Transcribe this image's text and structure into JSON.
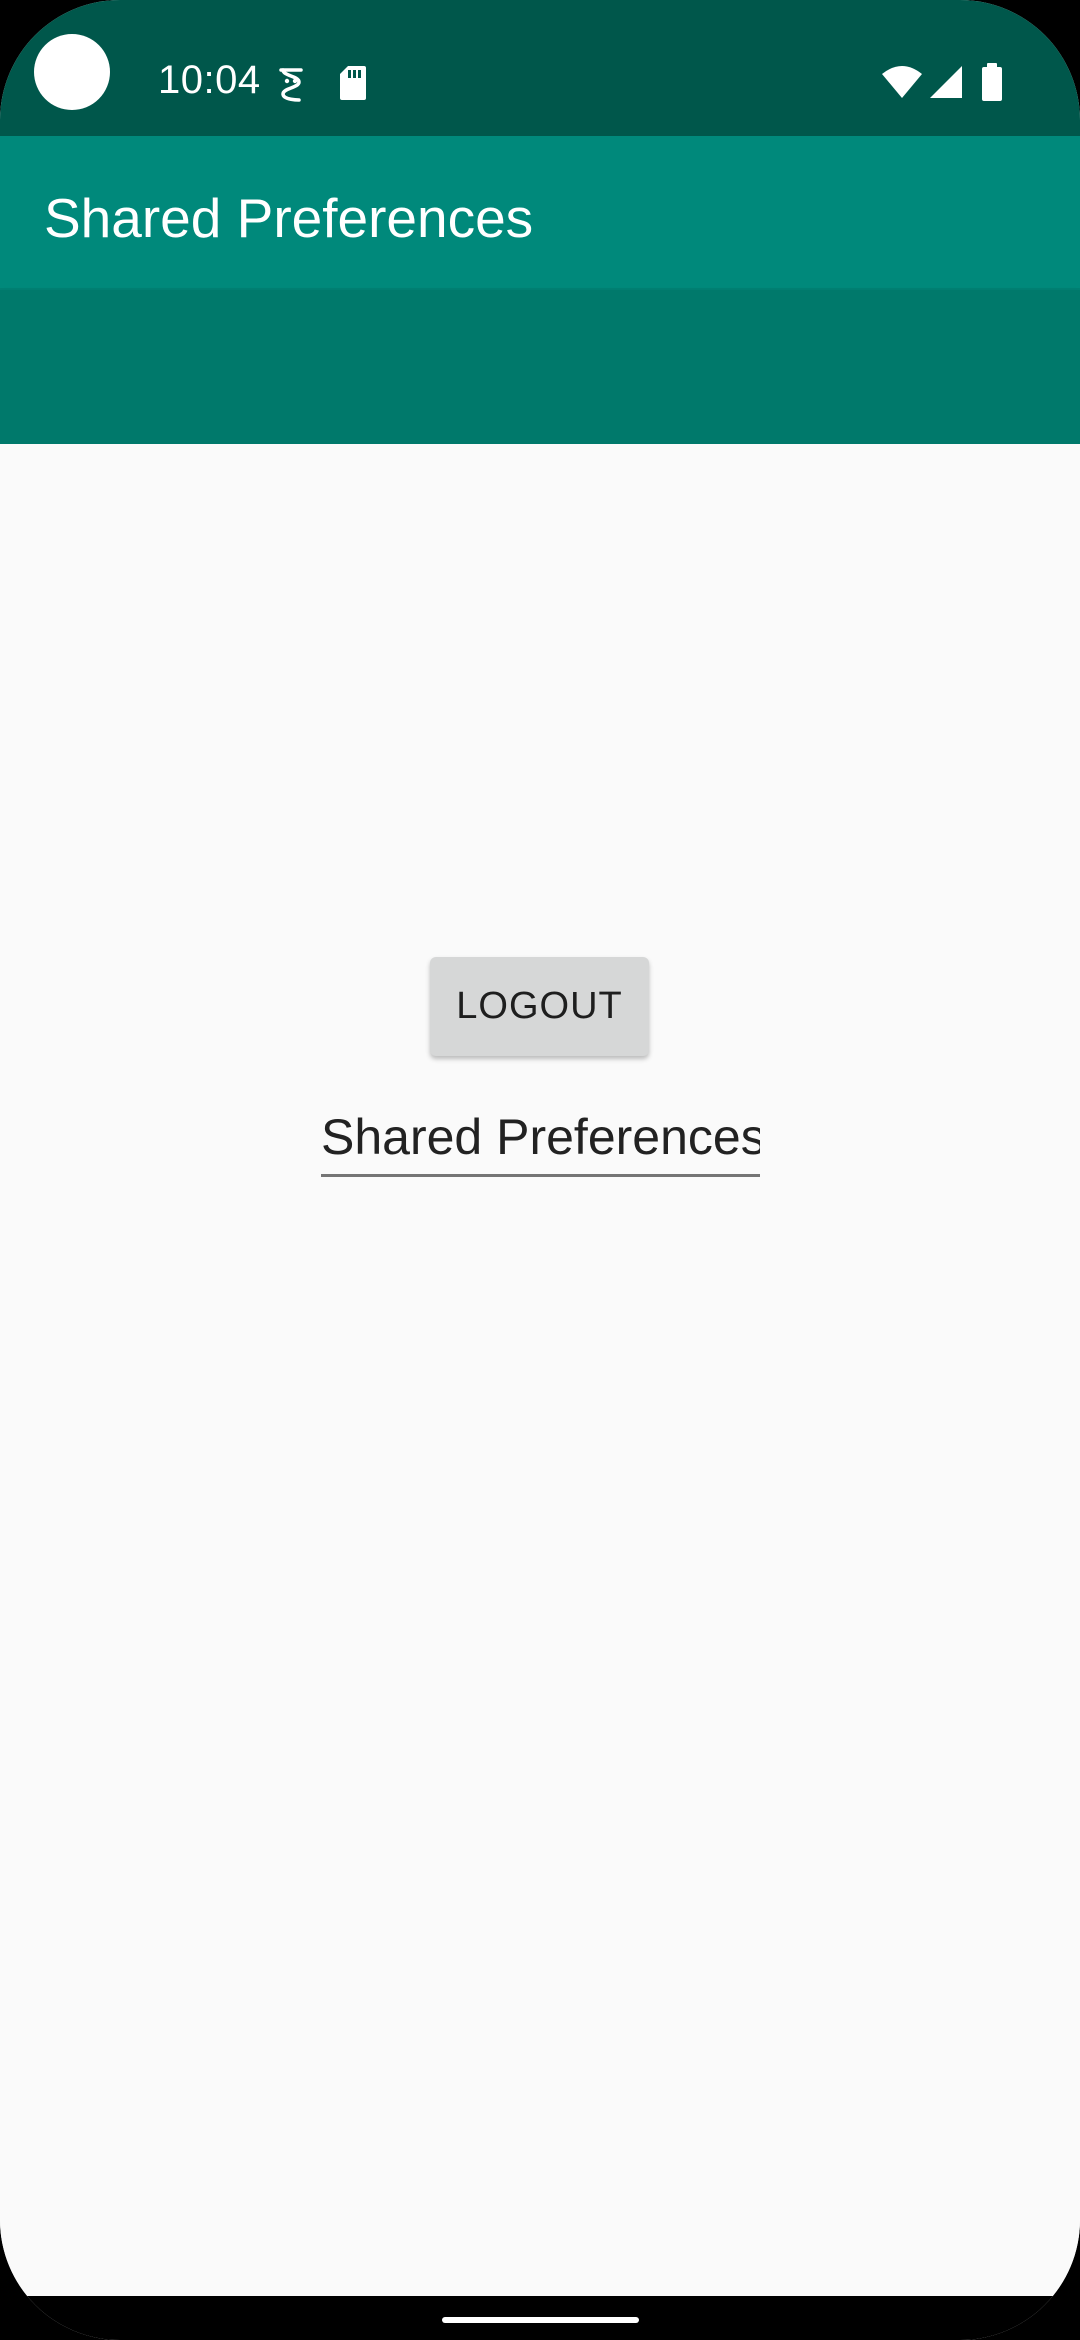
{
  "status_bar": {
    "time": "10:04",
    "icons": [
      "camera-cutout",
      "debug-icon",
      "sd-card-icon",
      "wifi-icon",
      "signal-icon",
      "battery-icon"
    ],
    "color": "#00574b"
  },
  "app_bar": {
    "title": "Shared Preferences",
    "color": "#00897b",
    "extended_color": "#00796b"
  },
  "main": {
    "logout_label": "LOGOUT",
    "field_value": "Shared Preferences"
  },
  "navigation": {
    "gesture_handle": "home-handle"
  }
}
